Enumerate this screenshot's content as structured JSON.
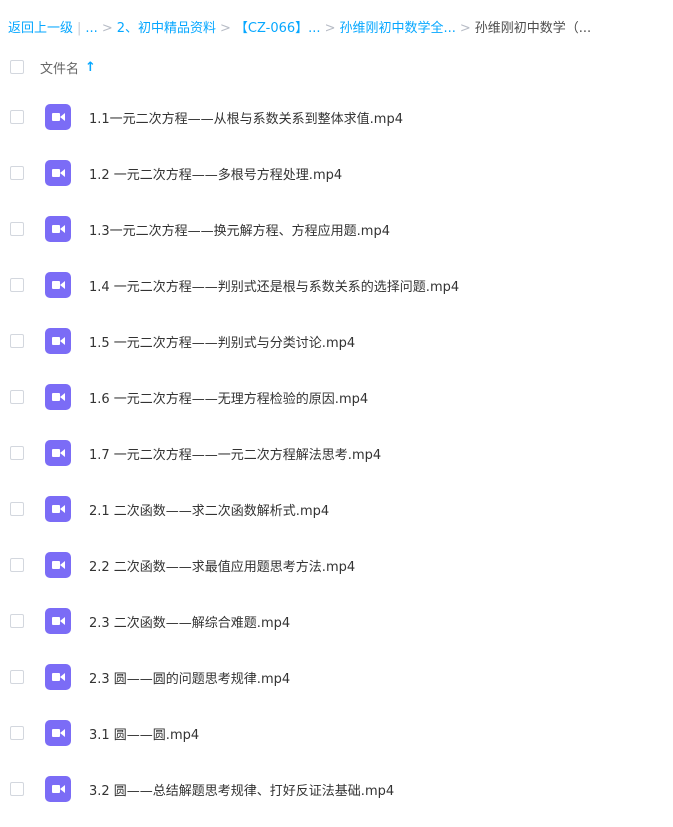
{
  "breadcrumb": {
    "back": "返回上一级",
    "pipe": "|",
    "ellipsis1": "...",
    "sep": ">",
    "crumb1": "2、初中精品资料",
    "crumb2": "【CZ-066】...",
    "crumb3": "孙维刚初中数学全...",
    "current": "孙维刚初中数学（..."
  },
  "header": {
    "column_label": "文件名",
    "sort_arrow": "↑"
  },
  "files": [
    {
      "name": "1.1一元二次方程——从根与系数关系到整体求值.mp4"
    },
    {
      "name": "1.2 一元二次方程——多根号方程处理.mp4"
    },
    {
      "name": "1.3一元二次方程——换元解方程、方程应用题.mp4"
    },
    {
      "name": "1.4 一元二次方程——判别式还是根与系数关系的选择问题.mp4"
    },
    {
      "name": "1.5 一元二次方程——判别式与分类讨论.mp4"
    },
    {
      "name": "1.6 一元二次方程——无理方程检验的原因.mp4"
    },
    {
      "name": "1.7 一元二次方程——一元二次方程解法思考.mp4"
    },
    {
      "name": "2.1 二次函数——求二次函数解析式.mp4"
    },
    {
      "name": "2.2 二次函数——求最值应用题思考方法.mp4"
    },
    {
      "name": "2.3 二次函数——解综合难题.mp4"
    },
    {
      "name": "2.3 圆——圆的问题思考规律.mp4"
    },
    {
      "name": "3.1 圆——圆.mp4"
    },
    {
      "name": "3.2 圆——总结解题思考规律、打好反证法基础.mp4"
    }
  ],
  "colors": {
    "link": "#06a7ff",
    "video_icon": "#7b6cf6"
  },
  "icons": {
    "file": "video-file-icon"
  }
}
